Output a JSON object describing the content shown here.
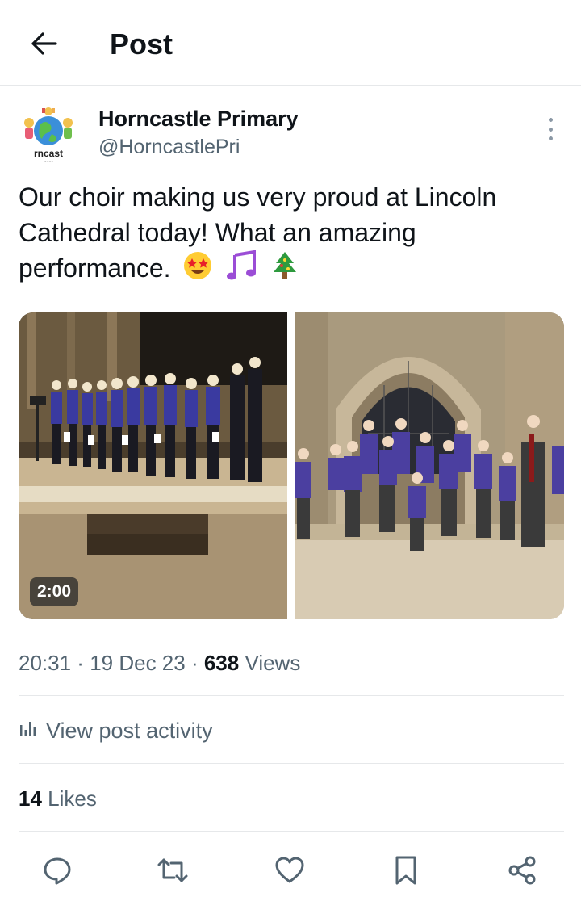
{
  "header": {
    "title": "Post"
  },
  "author": {
    "name": "Horncastle Primary",
    "handle": "@HorncastlePri",
    "avatar_text": "rncast"
  },
  "post": {
    "text": "Our choir making us very proud at Lincoln Cathedral today! What an amazing performance.",
    "emojis": [
      "star-struck",
      "musical-notes",
      "christmas-tree"
    ]
  },
  "media": {
    "video_duration": "2:00"
  },
  "meta": {
    "time": "20:31",
    "sep1": " · ",
    "date": "19 Dec 23",
    "sep2": " · ",
    "views_count": "638",
    "views_label": " Views"
  },
  "activity": {
    "label": "View post activity"
  },
  "likes": {
    "count": "14",
    "label": " Likes"
  },
  "icons": [
    "back-arrow-icon",
    "more-options-icon",
    "chart-icon",
    "reply-icon",
    "repost-icon",
    "like-icon",
    "bookmark-icon",
    "share-icon"
  ],
  "colors": {
    "text": "#0f1419",
    "secondary": "#536471",
    "uniform": "#4b3fa0"
  }
}
